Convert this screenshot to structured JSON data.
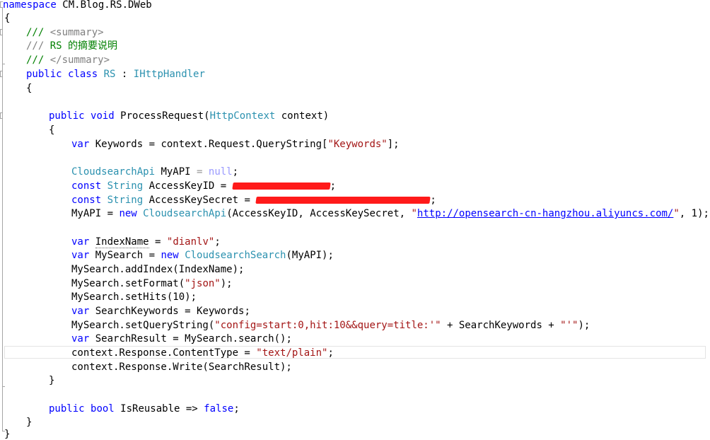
{
  "code": {
    "l1": {
      "kw": "namespace",
      "text": " CM.Blog.RS.DWeb"
    },
    "l2": "{",
    "l3": {
      "slashes": "/// ",
      "tag": "<summary>"
    },
    "l4": {
      "slashes": "/// ",
      "text": "RS 的摘要说明"
    },
    "l5": {
      "slashes": "/// ",
      "tag": "</summary>"
    },
    "l6": {
      "kw1": "public",
      "kw2": "class",
      "name": "RS",
      "colon": " : ",
      "iface": "IHttpHandler"
    },
    "l7": "{",
    "l9": {
      "kw1": "public",
      "kw2": "void",
      "name": " ProcessRequest(",
      "type": "HttpContext",
      "rest": " context)"
    },
    "l10": "{",
    "l11": {
      "kw": "var",
      "pre": " Keywords = context.Request.QueryString[",
      "str": "\"Keywords\"",
      "post": "];"
    },
    "l13": {
      "type": "CloudsearchApi",
      "mid": " MyAPI ",
      "eq": "= ",
      "nullkw": "null",
      "end": ";"
    },
    "l14": {
      "kw": "const",
      "type": "String",
      "name": " AccessKeyID = ",
      "end": ";"
    },
    "l15": {
      "kw": "const",
      "type": "String",
      "name": " AccessKeySecret = ",
      "end": ";"
    },
    "l16": {
      "pre": "MyAPI = ",
      "kw": "new",
      "type": "CloudsearchApi",
      "args": "(AccessKeyID, AccessKeySecret, ",
      "q1": "\"",
      "url": "http://opensearch-cn-hangzhou.aliyuncs.com/",
      "q2": "\"",
      "end": ", 1);"
    },
    "l18": {
      "kw": "var",
      "sp": " ",
      "name": "IndexName",
      "eq": " = ",
      "str": "\"dianlv\"",
      "end": ";"
    },
    "l19": {
      "kw": "var",
      "mid": " MySearch = ",
      "kw2": "new",
      "type": "CloudsearchSearch",
      "end": "(MyAPI);"
    },
    "l20": "MySearch.addIndex(IndexName);",
    "l21": {
      "pre": "MySearch.setFormat(",
      "str": "\"json\"",
      "end": ");"
    },
    "l22": "MySearch.setHits(10);",
    "l23": {
      "kw": "var",
      "end": " SearchKeywords = Keywords;"
    },
    "l24": {
      "pre": "MySearch.setQueryString(",
      "str": "\"config=start:0,hit:10&&query=title:'\"",
      "mid": " + SearchKeywords + ",
      "str2": "\"'\"",
      "end": ");"
    },
    "l25": {
      "kw": "var",
      "end": " SearchResult = MySearch.search();"
    },
    "l26": {
      "pre": "context.Response.ContentType = ",
      "str": "\"text/plain\"",
      "end": ";"
    },
    "l27": "context.Response.Write(SearchResult);",
    "l28": "}",
    "l30": {
      "kw1": "public",
      "kw2": "bool",
      "name": " IsReusable => ",
      "kw3": "false",
      "end": ";"
    },
    "l31": "}",
    "l32": "}"
  },
  "colors": {
    "keyword": "#0000ff",
    "type": "#2b91af",
    "string": "#a31515",
    "comment": "#008000",
    "redaction": "#ff1a1a"
  }
}
